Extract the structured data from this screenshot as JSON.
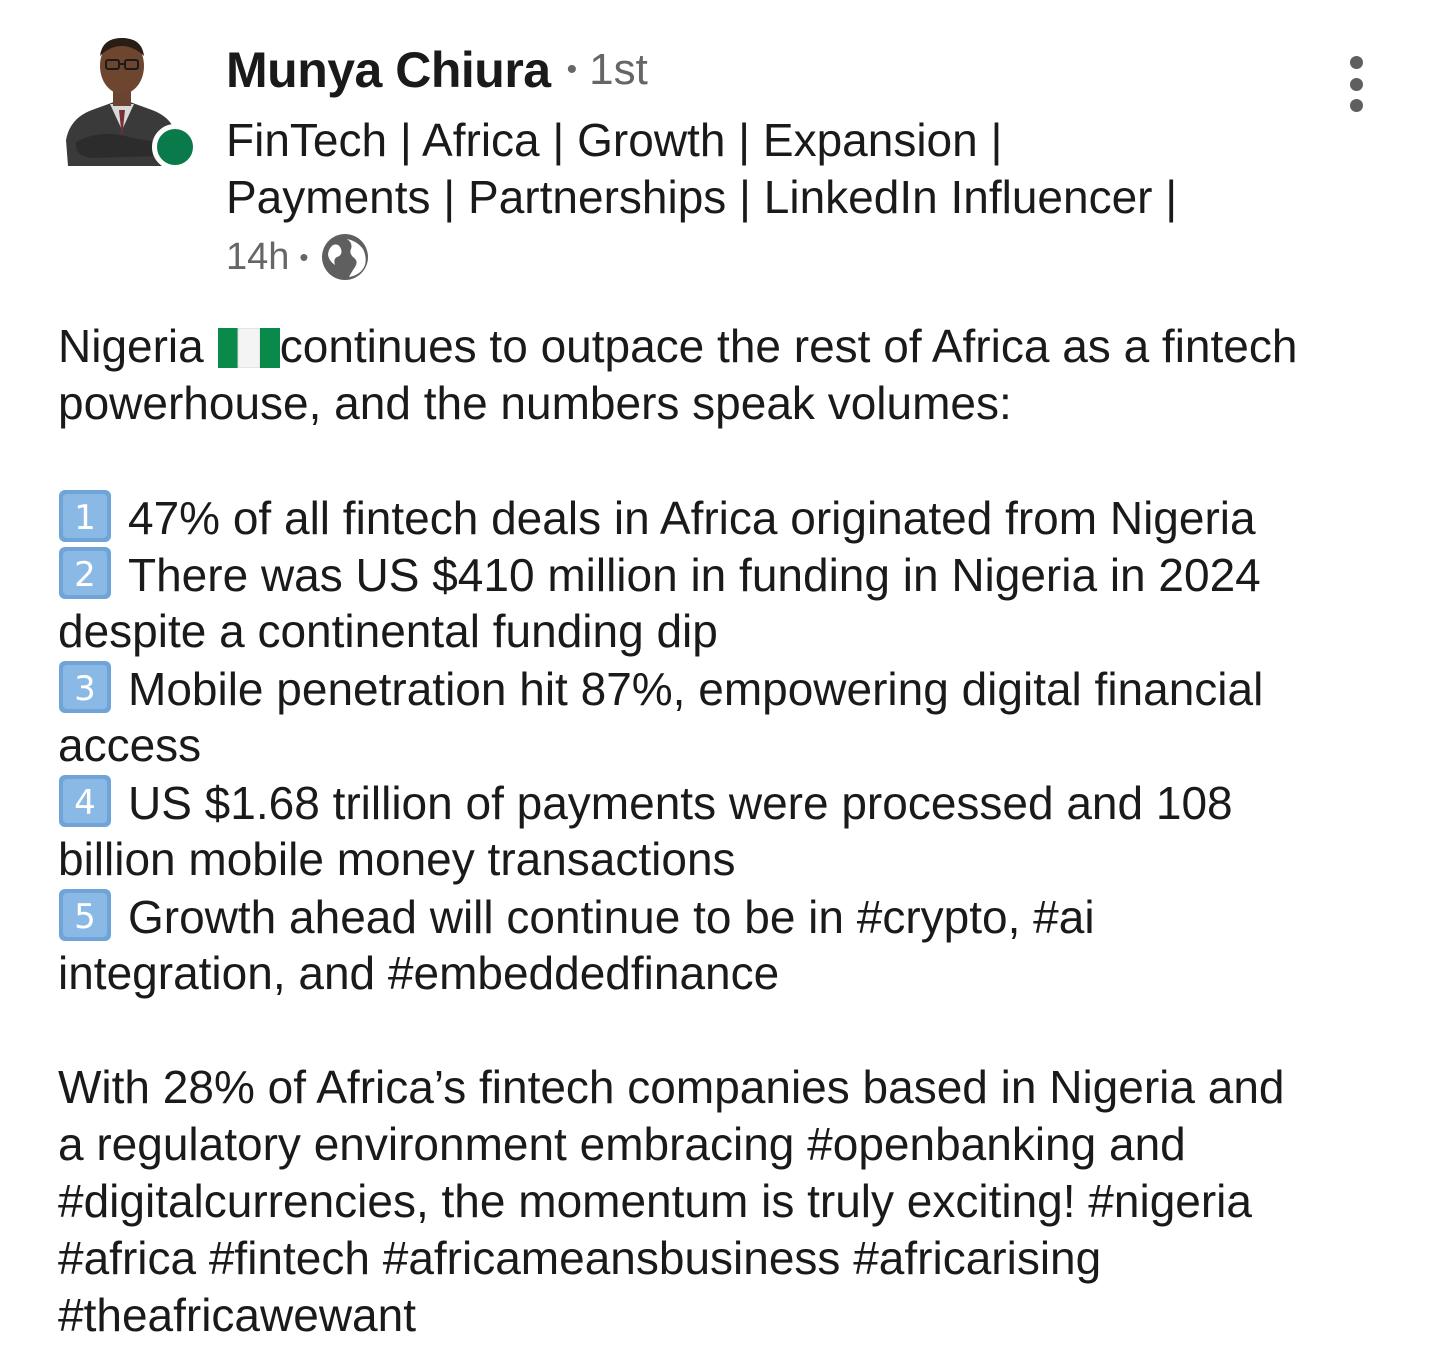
{
  "author": {
    "name": "Munya Chiura",
    "degree": "1st",
    "headline_lines": [
      "FinTech | Africa | Growth | Expansion |",
      "Payments | Partnerships | LinkedIn Influencer |"
    ],
    "timestamp": "14h",
    "visibility_icon": "globe-icon",
    "status": "online",
    "status_color": "#0a7a4a"
  },
  "post": {
    "intro_a": "Nigeria",
    "intro_flag": "nigeria-flag",
    "intro_b": "continues to outpace the rest of Africa as a fintech",
    "intro_line2": "powerhouse, and the numbers speak volumes:",
    "points": [
      {
        "num": "1",
        "lines": [
          "47% of all fintech deals in Africa originated from Nigeria"
        ]
      },
      {
        "num": "2",
        "lines": [
          "There was US $410 million in funding in Nigeria in 2024",
          "despite a continental funding dip"
        ]
      },
      {
        "num": "3",
        "lines": [
          "Mobile penetration hit 87%, empowering digital financial",
          "access"
        ]
      },
      {
        "num": "4",
        "lines": [
          "US $1.68 trillion of payments were processed and 108",
          "billion mobile money transactions"
        ]
      },
      {
        "num": "5",
        "lines": [
          "Growth ahead will continue to be in #crypto, #ai",
          "integration, and #embeddedfinance"
        ]
      }
    ],
    "closing_lines": [
      "With 28% of Africa’s fintech companies based in Nigeria and",
      "a regulatory environment embracing #openbanking and",
      "#digitalcurrencies, the momentum is truly exciting! #nigeria",
      "#africa #fintech #africameansbusiness #africarising",
      "#theafricawewant"
    ]
  },
  "colors": {
    "text": "#1a1a1a",
    "muted": "#666666",
    "keycap": "#6fa4d8"
  }
}
